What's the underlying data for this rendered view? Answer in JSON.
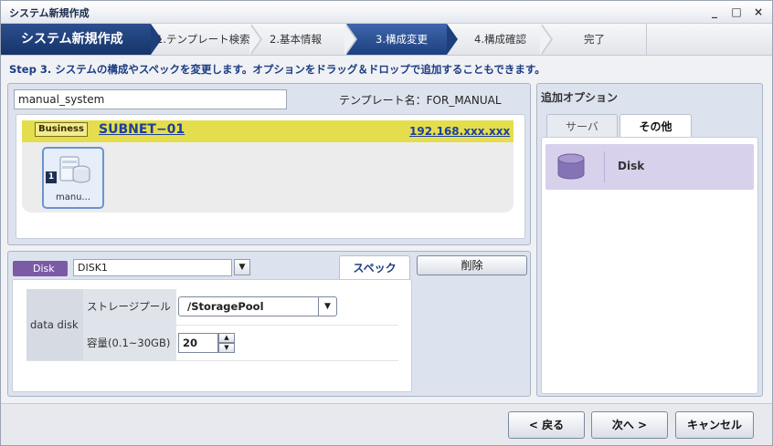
{
  "window": {
    "title": "システム新規作成",
    "controls": [
      "_",
      "□",
      "×"
    ]
  },
  "steps": {
    "main": "システム新規作成",
    "items": [
      "1.テンプレート検索",
      "2.基本情報",
      "3.構成変更",
      "4.構成確認",
      "完了"
    ],
    "active_index": 2
  },
  "step_description": "Step 3. システムの構成やスペックを変更します。オプションをドラッグ＆ドロップで追加することもできます。",
  "config": {
    "system_name": "manual_system",
    "template_label": "テンプレート名：FOR_MANUAL",
    "subnet": {
      "tag": "Business",
      "name": "SUBNET−01",
      "address": "192.168.xxx.xxx"
    },
    "node": {
      "number": "1",
      "label": "manu..."
    }
  },
  "detail": {
    "type_badge": "Disk",
    "name_value": "DISK1",
    "tab_label": "スペック",
    "delete_label": "削除",
    "section_label": "data disk",
    "rows": [
      {
        "label": "ストレージプール",
        "value": "/StoragePool"
      },
      {
        "label": "容量(0.1~30GB)",
        "value": "20"
      }
    ]
  },
  "options": {
    "title": "追加オプション",
    "tabs": [
      "サーバ",
      "その他"
    ],
    "active_tab": "その他",
    "items": [
      {
        "label": "Disk",
        "icon": "disk-icon"
      }
    ]
  },
  "footer": {
    "back": "< 戻る",
    "next": "次へ >",
    "cancel": "キャンセル"
  },
  "colors": {
    "accent": "#1d3f7e",
    "subnet_bar": "#e4dd4e",
    "option_item": "#d7d1ec",
    "disk_badge": "#7b5aa6"
  }
}
